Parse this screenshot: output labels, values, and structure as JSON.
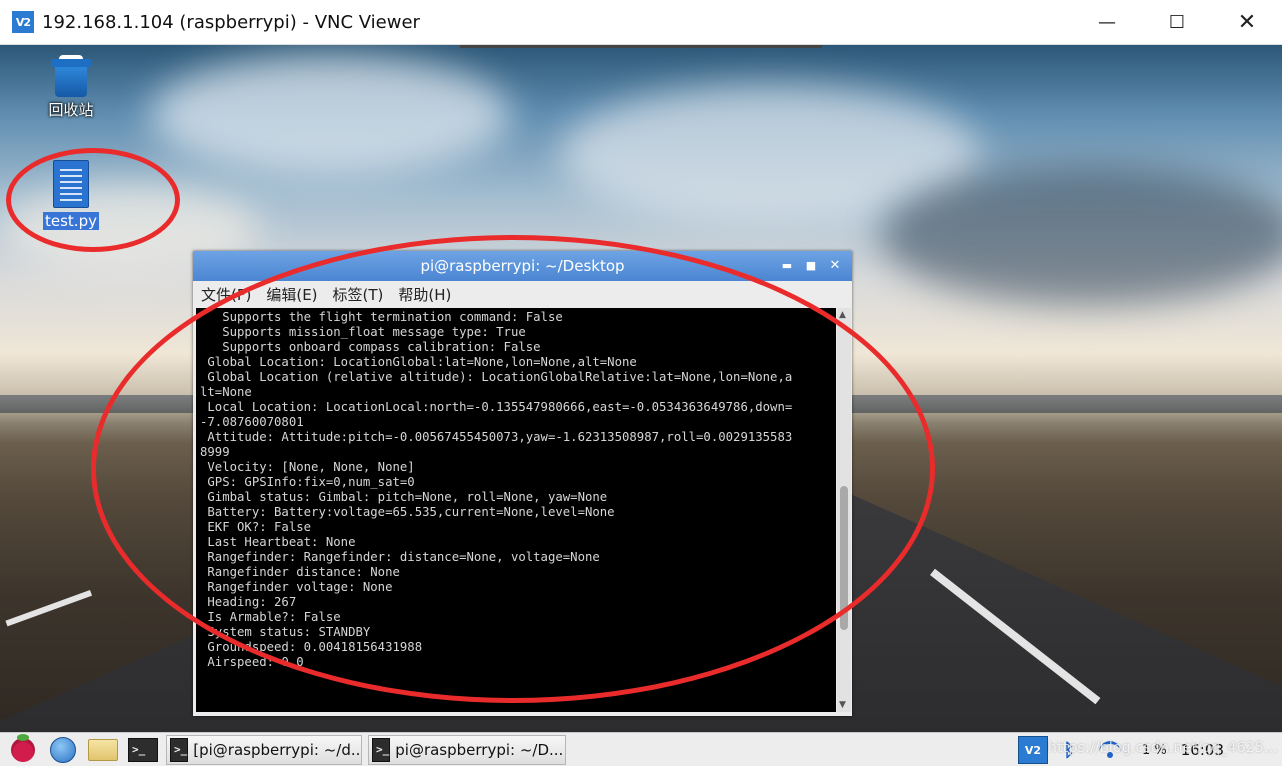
{
  "vnc_window": {
    "title": "192.168.1.104 (raspberrypi) - VNC Viewer",
    "logo_text": "V2",
    "minimize_glyph": "—",
    "maximize_glyph": "☐",
    "close_glyph": "✕"
  },
  "desktop_icons": [
    {
      "label": "回收站",
      "icon": "trash-icon",
      "selected": false
    },
    {
      "label": "test.py",
      "icon": "python-file-icon",
      "selected": true
    }
  ],
  "annotation_color": "#ea2b2b",
  "terminal": {
    "title": "pi@raspberrypi: ~/Desktop",
    "menus": [
      "文件(F)",
      "编辑(E)",
      "标签(T)",
      "帮助(H)"
    ],
    "lines": [
      "   Supports the flight termination command: False",
      "   Supports mission_float message type: True",
      "   Supports onboard compass calibration: False",
      " Global Location: LocationGlobal:lat=None,lon=None,alt=None",
      " Global Location (relative altitude): LocationGlobalRelative:lat=None,lon=None,a",
      "lt=None",
      " Local Location: LocationLocal:north=-0.135547980666,east=-0.0534363649786,down=",
      "-7.08760070801",
      " Attitude: Attitude:pitch=-0.00567455450073,yaw=-1.62313508987,roll=0.0029135583",
      "8999",
      " Velocity: [None, None, None]",
      " GPS: GPSInfo:fix=0,num_sat=0",
      " Gimbal status: Gimbal: pitch=None, roll=None, yaw=None",
      " Battery: Battery:voltage=65.535,current=None,level=None",
      " EKF OK?: False",
      " Last Heartbeat: None",
      " Rangefinder: Rangefinder: distance=None, voltage=None",
      " Rangefinder distance: None",
      " Rangefinder voltage: None",
      " Heading: 267",
      " Is Armable?: False",
      " System status: STANDBY",
      " Groundspeed: 0.00418156431988",
      " Airspeed: 0.0"
    ]
  },
  "taskbar": {
    "launchers": [
      "raspberry-menu-icon",
      "browser-globe-icon",
      "file-manager-icon",
      "terminal-icon"
    ],
    "tasks": [
      {
        "label": "[pi@raspberrypi: ~/d..."
      },
      {
        "label": "pi@raspberrypi: ~/D..."
      }
    ],
    "terminal_glyph": ">_",
    "vnc_tray_text": "V2",
    "bluetooth_glyph": "ᛒ",
    "cpu": "1 %",
    "clock": "16:03",
    "watermark": "https://blog.csdn.net/qq_4625..."
  }
}
